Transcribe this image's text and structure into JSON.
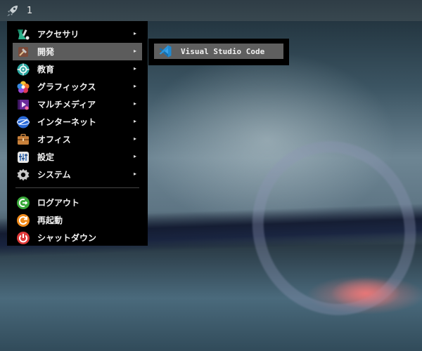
{
  "panel": {
    "launcher_icon": "rocket-icon",
    "workspace": "1"
  },
  "menu": {
    "items": [
      {
        "label": "アクセサリ",
        "icon": "accessories-icon",
        "has_submenu": true
      },
      {
        "label": "開発",
        "icon": "development-icon",
        "has_submenu": true,
        "active": true
      },
      {
        "label": "教育",
        "icon": "education-icon",
        "has_submenu": true
      },
      {
        "label": "グラフィックス",
        "icon": "graphics-icon",
        "has_submenu": true
      },
      {
        "label": "マルチメディア",
        "icon": "multimedia-icon",
        "has_submenu": true
      },
      {
        "label": "インターネット",
        "icon": "internet-icon",
        "has_submenu": true
      },
      {
        "label": "オフィス",
        "icon": "office-icon",
        "has_submenu": true
      },
      {
        "label": "設定",
        "icon": "settings-icon",
        "has_submenu": true
      },
      {
        "label": "システム",
        "icon": "system-icon",
        "has_submenu": true
      }
    ],
    "session_items": [
      {
        "label": "ログアウト",
        "icon": "logout-icon"
      },
      {
        "label": "再起動",
        "icon": "reboot-icon"
      },
      {
        "label": "シャットダウン",
        "icon": "shutdown-icon"
      }
    ],
    "arrow": "▸"
  },
  "submenu": {
    "items": [
      {
        "label": "Visual Studio Code",
        "icon": "vscode-icon"
      }
    ]
  },
  "colors": {
    "menu_bg": "#000000",
    "active_bg": "#5c5c5c",
    "panel_bg": "#333f48"
  }
}
